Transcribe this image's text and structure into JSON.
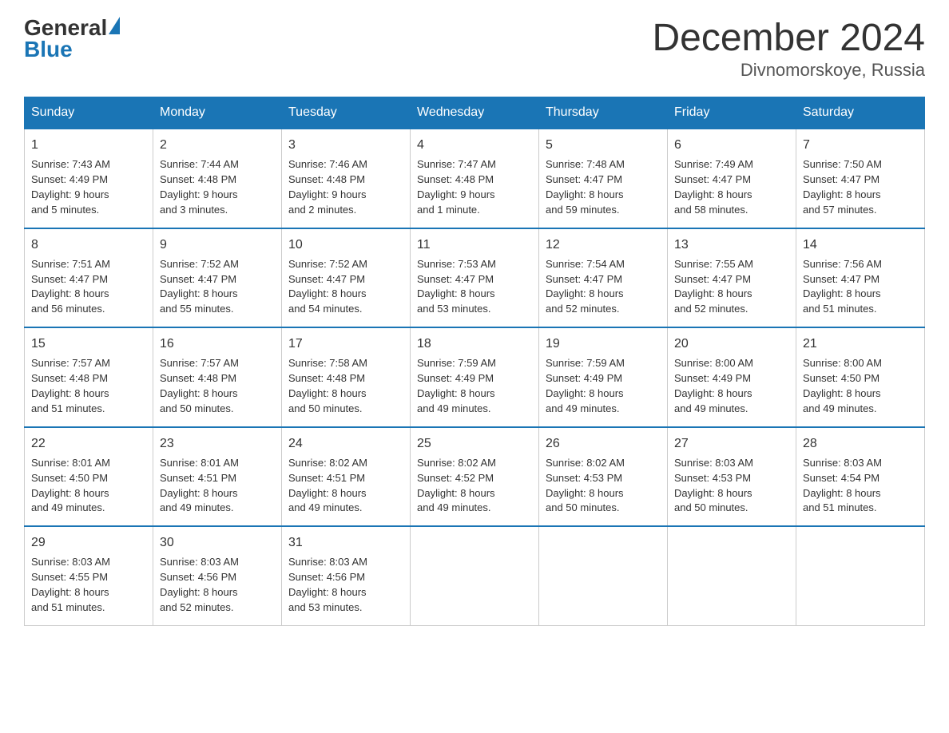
{
  "header": {
    "logo_general": "General",
    "logo_blue": "Blue",
    "title": "December 2024",
    "location": "Divnomorskoye, Russia"
  },
  "days_of_week": [
    "Sunday",
    "Monday",
    "Tuesday",
    "Wednesday",
    "Thursday",
    "Friday",
    "Saturday"
  ],
  "weeks": [
    [
      {
        "day": "1",
        "sunrise": "7:43 AM",
        "sunset": "4:49 PM",
        "daylight": "9 hours and 5 minutes."
      },
      {
        "day": "2",
        "sunrise": "7:44 AM",
        "sunset": "4:48 PM",
        "daylight": "9 hours and 3 minutes."
      },
      {
        "day": "3",
        "sunrise": "7:46 AM",
        "sunset": "4:48 PM",
        "daylight": "9 hours and 2 minutes."
      },
      {
        "day": "4",
        "sunrise": "7:47 AM",
        "sunset": "4:48 PM",
        "daylight": "9 hours and 1 minute."
      },
      {
        "day": "5",
        "sunrise": "7:48 AM",
        "sunset": "4:47 PM",
        "daylight": "8 hours and 59 minutes."
      },
      {
        "day": "6",
        "sunrise": "7:49 AM",
        "sunset": "4:47 PM",
        "daylight": "8 hours and 58 minutes."
      },
      {
        "day": "7",
        "sunrise": "7:50 AM",
        "sunset": "4:47 PM",
        "daylight": "8 hours and 57 minutes."
      }
    ],
    [
      {
        "day": "8",
        "sunrise": "7:51 AM",
        "sunset": "4:47 PM",
        "daylight": "8 hours and 56 minutes."
      },
      {
        "day": "9",
        "sunrise": "7:52 AM",
        "sunset": "4:47 PM",
        "daylight": "8 hours and 55 minutes."
      },
      {
        "day": "10",
        "sunrise": "7:52 AM",
        "sunset": "4:47 PM",
        "daylight": "8 hours and 54 minutes."
      },
      {
        "day": "11",
        "sunrise": "7:53 AM",
        "sunset": "4:47 PM",
        "daylight": "8 hours and 53 minutes."
      },
      {
        "day": "12",
        "sunrise": "7:54 AM",
        "sunset": "4:47 PM",
        "daylight": "8 hours and 52 minutes."
      },
      {
        "day": "13",
        "sunrise": "7:55 AM",
        "sunset": "4:47 PM",
        "daylight": "8 hours and 52 minutes."
      },
      {
        "day": "14",
        "sunrise": "7:56 AM",
        "sunset": "4:47 PM",
        "daylight": "8 hours and 51 minutes."
      }
    ],
    [
      {
        "day": "15",
        "sunrise": "7:57 AM",
        "sunset": "4:48 PM",
        "daylight": "8 hours and 51 minutes."
      },
      {
        "day": "16",
        "sunrise": "7:57 AM",
        "sunset": "4:48 PM",
        "daylight": "8 hours and 50 minutes."
      },
      {
        "day": "17",
        "sunrise": "7:58 AM",
        "sunset": "4:48 PM",
        "daylight": "8 hours and 50 minutes."
      },
      {
        "day": "18",
        "sunrise": "7:59 AM",
        "sunset": "4:49 PM",
        "daylight": "8 hours and 49 minutes."
      },
      {
        "day": "19",
        "sunrise": "7:59 AM",
        "sunset": "4:49 PM",
        "daylight": "8 hours and 49 minutes."
      },
      {
        "day": "20",
        "sunrise": "8:00 AM",
        "sunset": "4:49 PM",
        "daylight": "8 hours and 49 minutes."
      },
      {
        "day": "21",
        "sunrise": "8:00 AM",
        "sunset": "4:50 PM",
        "daylight": "8 hours and 49 minutes."
      }
    ],
    [
      {
        "day": "22",
        "sunrise": "8:01 AM",
        "sunset": "4:50 PM",
        "daylight": "8 hours and 49 minutes."
      },
      {
        "day": "23",
        "sunrise": "8:01 AM",
        "sunset": "4:51 PM",
        "daylight": "8 hours and 49 minutes."
      },
      {
        "day": "24",
        "sunrise": "8:02 AM",
        "sunset": "4:51 PM",
        "daylight": "8 hours and 49 minutes."
      },
      {
        "day": "25",
        "sunrise": "8:02 AM",
        "sunset": "4:52 PM",
        "daylight": "8 hours and 49 minutes."
      },
      {
        "day": "26",
        "sunrise": "8:02 AM",
        "sunset": "4:53 PM",
        "daylight": "8 hours and 50 minutes."
      },
      {
        "day": "27",
        "sunrise": "8:03 AM",
        "sunset": "4:53 PM",
        "daylight": "8 hours and 50 minutes."
      },
      {
        "day": "28",
        "sunrise": "8:03 AM",
        "sunset": "4:54 PM",
        "daylight": "8 hours and 51 minutes."
      }
    ],
    [
      {
        "day": "29",
        "sunrise": "8:03 AM",
        "sunset": "4:55 PM",
        "daylight": "8 hours and 51 minutes."
      },
      {
        "day": "30",
        "sunrise": "8:03 AM",
        "sunset": "4:56 PM",
        "daylight": "8 hours and 52 minutes."
      },
      {
        "day": "31",
        "sunrise": "8:03 AM",
        "sunset": "4:56 PM",
        "daylight": "8 hours and 53 minutes."
      },
      null,
      null,
      null,
      null
    ]
  ],
  "labels": {
    "sunrise": "Sunrise:",
    "sunset": "Sunset:",
    "daylight": "Daylight:"
  }
}
